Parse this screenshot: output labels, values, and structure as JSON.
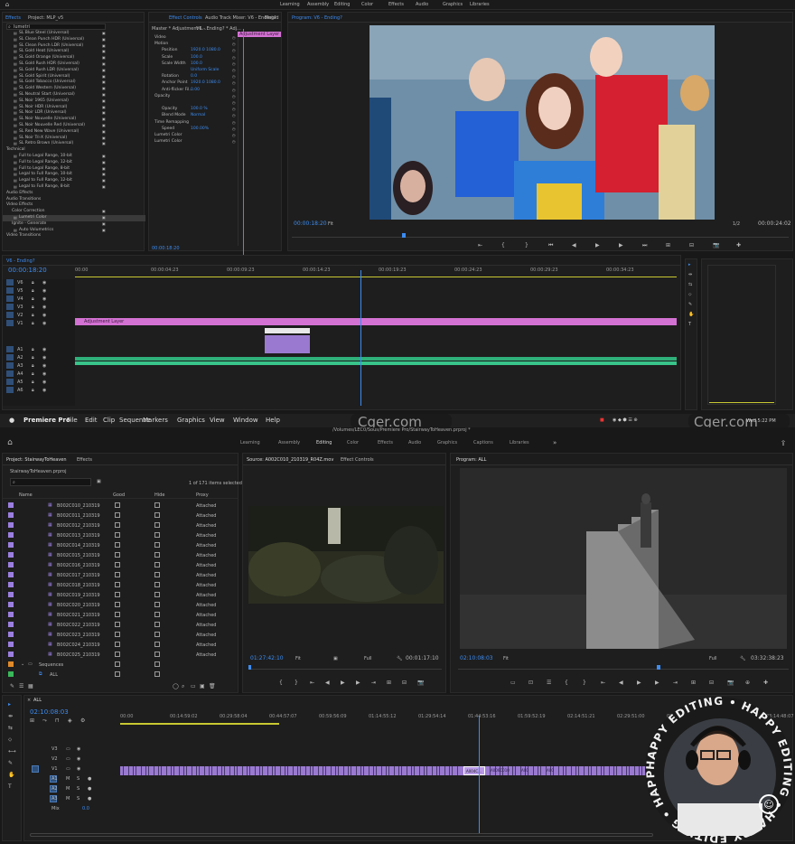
{
  "top": {
    "workspace_tabs": [
      "Learning",
      "Assembly",
      "Editing",
      "Color",
      "Effects",
      "Audio",
      "Graphics",
      "Libraries"
    ],
    "effects_panel": {
      "tabs": [
        "Effects",
        "Project: MLP_v5"
      ],
      "search": "lumetri",
      "items": [
        "SL Blue Steel (Universal)",
        "SL Clean Punch HDR (Universal)",
        "SL Clean Punch LDR (Universal)",
        "SL Gold Heat (Universal)",
        "SL Gold Orange (Universal)",
        "SL Gold Rush HDR (Universal)",
        "SL Gold Rush LDR (Universal)",
        "SL Gold Spirit (Universal)",
        "SL Gold Tobacco (Universal)",
        "SL Gold Western (Universal)",
        "SL Neutral Start (Universal)",
        "SL Noir 1965 (Universal)",
        "SL Noir HDR (Universal)",
        "SL Noir LDR (Universal)",
        "SL Noir Nouvelle (Universal)",
        "SL Noir Nouvelle Red (Universal)",
        "SL Red New Wave (Universal)",
        "SL Noir Tri-X (Universal)",
        "SL Retro Brown (Universal)",
        "Technical",
        "Full to Legal Range, 10-bit",
        "Full to Legal Range, 12-bit",
        "Full to Legal Range, 8-bit",
        "Legal to Full Range, 10-bit",
        "Legal to Full Range, 12-bit",
        "Legal to Full Range, 8-bit",
        "Audio Effects",
        "Audio Transitions",
        "Video Effects",
        "Color Correction",
        "Lumetri Color",
        "Ignite - Generate",
        "Auto Volumetrics",
        "Video Transitions"
      ]
    },
    "effect_controls": {
      "tabs": [
        "Effect Controls",
        "Audio Track Mixer: V6 - Ending?",
        "Metad"
      ],
      "source": "Master * Adjustment L...",
      "seq": "V6 - Ending? * Adj...",
      "clip_label": "Adjustment Layer",
      "rows": [
        {
          "n": "Video",
          "v": ""
        },
        {
          "n": "Motion",
          "v": ""
        },
        {
          "n": "Position",
          "v": "1920.0   1080.0"
        },
        {
          "n": "Scale",
          "v": "100.0"
        },
        {
          "n": "Scale Width",
          "v": "100.0"
        },
        {
          "n": "",
          "v": "Uniform Scale"
        },
        {
          "n": "Rotation",
          "v": "0.0"
        },
        {
          "n": "Anchor Point",
          "v": "1920.0   1080.0"
        },
        {
          "n": "Anti-flicker Fil...",
          "v": "0.00"
        },
        {
          "n": "Opacity",
          "v": ""
        },
        {
          "n": "",
          "v": ""
        },
        {
          "n": "Opacity",
          "v": "100.0 %"
        },
        {
          "n": "Blend Mode",
          "v": "Normal"
        },
        {
          "n": "Time Remapping",
          "v": ""
        },
        {
          "n": "Speed",
          "v": "100.00%"
        },
        {
          "n": "Lumetri Color",
          "v": ""
        },
        {
          "n": "Lumetri Color",
          "v": ""
        }
      ],
      "timecode": "00:00:18:20"
    },
    "program": {
      "title": "Program: V6 - Ending?",
      "timecode": "00:00:18:20",
      "fit": "Fit",
      "fraction": "1/2",
      "duration": "00:00:24:02"
    },
    "timeline": {
      "title": "V6 - Ending?",
      "timecode": "00:00:18:20",
      "ticks": [
        "00:00",
        "00:00:04:23",
        "00:00:09:23",
        "00:00:14:23",
        "00:00:19:23",
        "00:00:24:23",
        "00:00:29:23",
        "00:00:34:23"
      ],
      "adj_label": "Adjustment Layer",
      "track_labels": [
        "V6",
        "V5",
        "V4",
        "V3",
        "V2",
        "V1",
        "A1",
        "A2",
        "A3",
        "A4",
        "A5",
        "A6"
      ]
    }
  },
  "menubar": {
    "app": "Premiere Pro",
    "items": [
      "File",
      "Edit",
      "Clip",
      "Sequence",
      "Markers",
      "Graphics",
      "View",
      "Window",
      "Help"
    ],
    "path": "/Volumes/LEC0/Sous/Premiere Pro/StairwayToHeaven.prproj *",
    "watermark": "Cger.com",
    "clock": "Wed 5:22 PM"
  },
  "bottom": {
    "workspace_tabs": [
      "Learning",
      "Assembly",
      "Editing",
      "Color",
      "Effects",
      "Audio",
      "Graphics",
      "Captions",
      "Libraries"
    ],
    "project": {
      "tabs": [
        "Project: StairwayToHeaven",
        "Effects"
      ],
      "file": "StairwayToHeaven.prproj",
      "selection": "1 of 171 items selected",
      "columns": [
        "Name",
        "Good",
        "Hide",
        "Proxy"
      ],
      "rows": [
        "B002C010_210319",
        "B002C011_210319",
        "B002C012_210319",
        "B002C013_210319",
        "B002C014_210319",
        "B002C015_210319",
        "B002C016_210319",
        "B002C017_210319",
        "B002C018_210319",
        "B002C019_210319",
        "B002C020_210319",
        "B002C021_210319",
        "B002C022_210319",
        "B002C023_210319",
        "B002C024_210319",
        "B002C025_210319"
      ],
      "proxy": "Attached",
      "folder": "Sequences",
      "seq": "ALL"
    },
    "source": {
      "tabs": [
        "Source: A002C010_210319_R04Z.mov",
        "Effect Controls"
      ],
      "timecode": "01:27:42:10",
      "fit": "Fit",
      "res": "Full",
      "duration": "00:01:17:10"
    },
    "program": {
      "title": "Program: ALL",
      "timecode": "02:10:08:03",
      "fit": "Fit",
      "res": "Full",
      "duration": "03:32:38:23"
    },
    "timeline": {
      "title": "ALL",
      "timecode": "02:10:08:03",
      "ticks": [
        "00:00",
        "00:14:59:02",
        "00:29:58:04",
        "00:44:57:07",
        "00:59:56:09",
        "01:14:55:12",
        "01:29:54:14",
        "01:44:53:16",
        "01:59:52:19",
        "02:14:51:21",
        "02:29:51:00",
        "02:44:50:02",
        "02:59:49:05",
        "03:14:48:07"
      ],
      "tracks": [
        "V3",
        "V2",
        "V1",
        "A1",
        "A2",
        "A3",
        "Mix"
      ],
      "mix_val": "0.0",
      "clip_labels": [
        "A004C...",
        "A006C010",
        "A00",
        "A00"
      ]
    },
    "badge_text": "HAPPY EDITING"
  },
  "colors": {
    "pink": "#d472d4",
    "purple": "#9a7ad0",
    "green": "#2fb07a",
    "accent": "#3d8cf0"
  }
}
